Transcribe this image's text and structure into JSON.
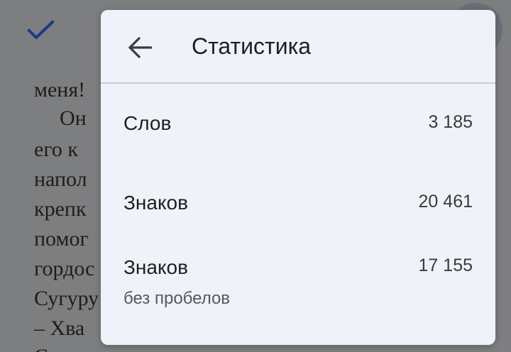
{
  "background": {
    "lines": [
      "меня!",
      "Он",
      "его к",
      "напол",
      "крепк",
      "помог",
      "гордос",
      "Сугуру",
      "– Хва",
      "С"
    ]
  },
  "dialog": {
    "title": "Статистика",
    "back_icon": "arrow-left-icon",
    "rows": [
      {
        "label": "Слов",
        "value": "3 185",
        "sublabel": ""
      },
      {
        "label": "Знаков",
        "value": "20 461",
        "sublabel": ""
      },
      {
        "label": "Знаков",
        "value": "17 155",
        "sublabel": "без пробелов"
      }
    ]
  },
  "colors": {
    "scrim": "#7d7e80",
    "dialog_bg": "#eff3f9",
    "check": "#1b3a8a"
  }
}
